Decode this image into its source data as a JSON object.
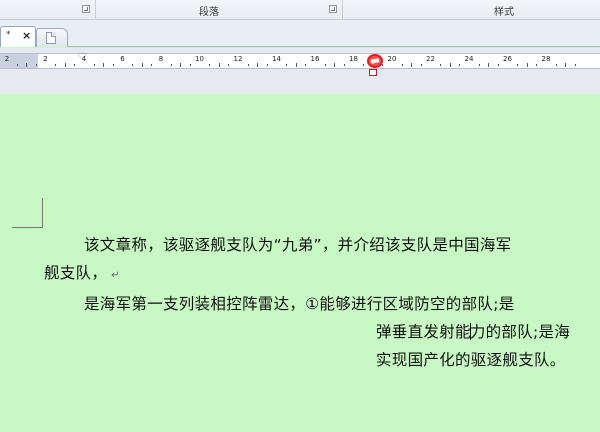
{
  "ribbon": {
    "groups": [
      {
        "label": ""
      },
      {
        "label": "段落"
      },
      {
        "label": "样式"
      }
    ]
  },
  "tabs": {
    "active": {
      "title": "*",
      "close": "×"
    },
    "new_tab_icon": "new-document-icon"
  },
  "ruler": {
    "numbers": [
      "2",
      "2",
      "4",
      "6",
      "8",
      "10",
      "12",
      "14",
      "16",
      "18",
      "20",
      "22",
      "24",
      "26",
      "28"
    ]
  },
  "document": {
    "line1": "该文章称，该驱逐舰支队为“九弟”，并介绍该支队是中国海军",
    "line2": "舰支队，",
    "paragraph_mark": "↵",
    "line3": "是海军第一支列装相控阵雷达，①能够进行区域防空的部队;是",
    "line4a": "弹垂直发射能",
    "line4b": "力的部队;是海",
    "line5": "实现国产化的驱逐舰支队。"
  },
  "colors": {
    "page_background": "#c8f9c4",
    "ruler_marker": "#e02020"
  }
}
